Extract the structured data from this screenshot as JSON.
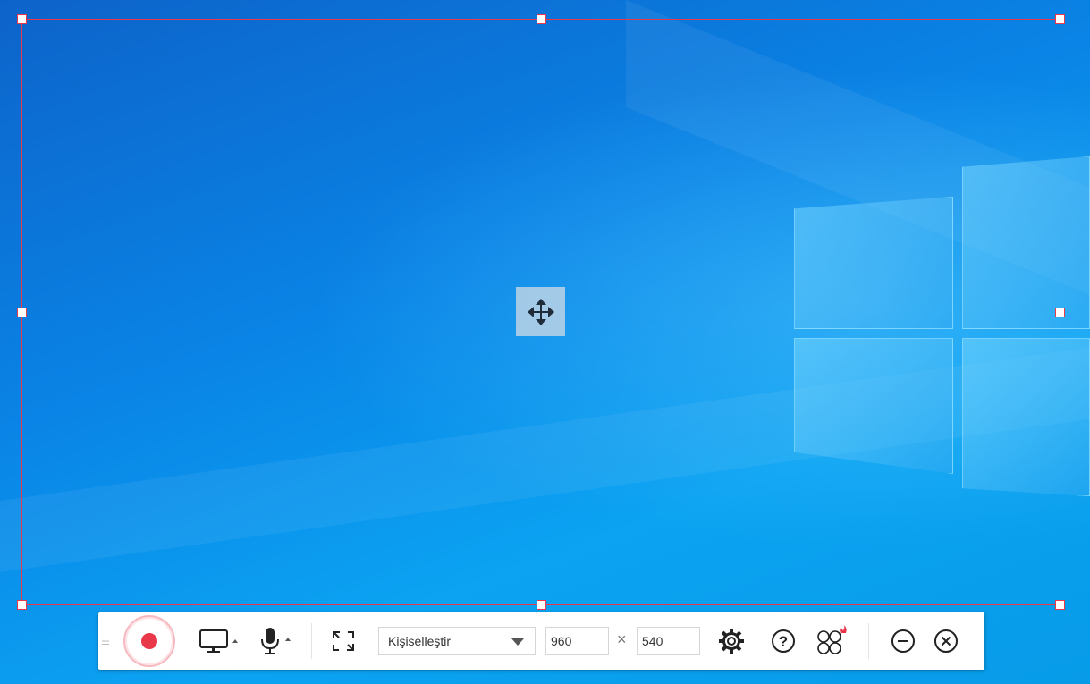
{
  "capture": {
    "move_icon": "move-arrows-icon"
  },
  "toolbar": {
    "grip_icon": "grip-icon",
    "record_icon": "record-icon",
    "screen_icon": "monitor-icon",
    "mic_icon": "microphone-icon",
    "fullscreen_icon": "expand-icon",
    "region_select": {
      "selected": "Kişiselleştir"
    },
    "width_value": "960",
    "height_value": "540",
    "times_sign": "×",
    "settings_icon": "gear-icon",
    "help_icon": "question-icon",
    "more_icon": "circles-icon",
    "minimize_icon": "minus-circle-icon",
    "close_icon": "close-circle-icon"
  },
  "colors": {
    "accent": "#e8384a",
    "toolbar_bg": "#ffffff",
    "icon": "#222222"
  }
}
